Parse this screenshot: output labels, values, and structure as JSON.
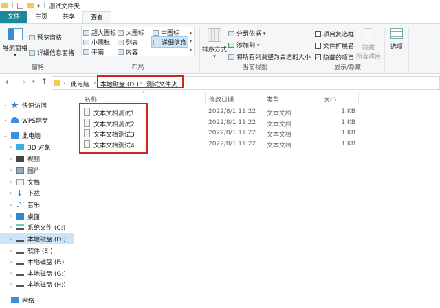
{
  "window": {
    "title": "测试文件夹"
  },
  "tabs": [
    "文件",
    "主页",
    "共享",
    "查看"
  ],
  "ribbon": {
    "panes": {
      "nav_pane": "导航窗格",
      "preview": "预览窗格",
      "details": "详细信息窗格",
      "label": "窗格"
    },
    "layout": {
      "items": [
        "超大图标",
        "大图标",
        "中图标",
        "小图标",
        "列表",
        "详细信息",
        "平铺",
        "内容"
      ],
      "label": "布局"
    },
    "view": {
      "sort": "排序方式",
      "group": "分组依据",
      "add_col": "添加列",
      "fit": "将所有列调整为合适的大小",
      "label": "当前视图"
    },
    "show": {
      "checkboxes": "项目复选框",
      "ext": "文件扩展名",
      "hidden": "隐藏的项目",
      "hidden_checked": true,
      "hide_sel_1": "隐藏",
      "hide_sel_2": "所选项目",
      "label": "显示/隐藏"
    },
    "options": "选项"
  },
  "address": {
    "crumbs": [
      "此电脑",
      "本地磁盘 (D:)",
      "测试文件夹"
    ]
  },
  "sidebar": [
    {
      "label": "快速访问",
      "color": "#2b7bd6"
    },
    {
      "label": "WPS网盘",
      "color": "#3a8fe0"
    },
    {
      "label": "此电脑",
      "color": "#3a8fe0"
    },
    {
      "label": "3D 对象",
      "color": "#3ab0e0"
    },
    {
      "label": "视频",
      "color": "#444"
    },
    {
      "label": "图片",
      "color": "#6a8ab0"
    },
    {
      "label": "文档",
      "color": "#bbb"
    },
    {
      "label": "下载",
      "color": "#2a7ad6"
    },
    {
      "label": "音乐",
      "color": "#2a7ad6"
    },
    {
      "label": "桌面",
      "color": "#2a8ad6"
    },
    {
      "label": "系统文件 (C:)",
      "color": "#6aa"
    },
    {
      "label": "本地磁盘 (D:)",
      "color": "#555"
    },
    {
      "label": "软件 (E:)",
      "color": "#555"
    },
    {
      "label": "本地磁盘 (F:)",
      "color": "#555"
    },
    {
      "label": "本地磁盘 (G:)",
      "color": "#555"
    },
    {
      "label": "本地磁盘 (H:)",
      "color": "#555"
    },
    {
      "label": "网络",
      "color": "#3a8fe0"
    }
  ],
  "columns": [
    "名称",
    "修改日期",
    "类型",
    "大小"
  ],
  "files": [
    {
      "name": "文本文档测试1",
      "date": "2022/8/1 11:22",
      "type": "文本文档",
      "size": "1 KB"
    },
    {
      "name": "文本文档测试2",
      "date": "2022/8/1 11:22",
      "type": "文本文档",
      "size": "1 KB"
    },
    {
      "name": "文本文档测试3",
      "date": "2022/8/1 11:22",
      "type": "文本文档",
      "size": "1 KB"
    },
    {
      "name": "文本文档测试4",
      "date": "2022/8/1 11:22",
      "type": "文本文档",
      "size": "1 KB"
    }
  ],
  "highlight_color": "#d22222"
}
